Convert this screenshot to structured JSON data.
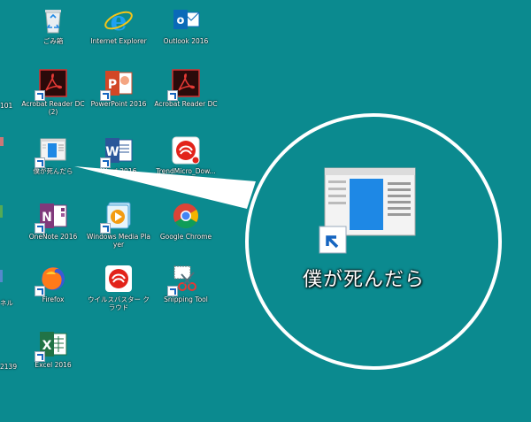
{
  "desktop": {
    "icons": [
      {
        "id": "recycle",
        "label": "ごみ箱"
      },
      {
        "id": "ie",
        "label": "Internet Explorer"
      },
      {
        "id": "outlook",
        "label": "Outlook 2016"
      },
      {
        "id": "acrobat2",
        "label": "Acrobat Reader DC (2)"
      },
      {
        "id": "powerpoint",
        "label": "PowerPoint 2016"
      },
      {
        "id": "acrobat",
        "label": "Acrobat Reader DC"
      },
      {
        "id": "bokuga",
        "label": "僕が死んだら"
      },
      {
        "id": "word",
        "label": "Word 2016"
      },
      {
        "id": "trendmicro",
        "label": "TrendMicro_Dow..."
      },
      {
        "id": "onenote",
        "label": "OneNote 2016"
      },
      {
        "id": "wmp",
        "label": "Windows Media Player"
      },
      {
        "id": "chrome",
        "label": "Google Chrome"
      },
      {
        "id": "firefox",
        "label": "Firefox"
      },
      {
        "id": "virusbuster",
        "label": "ウイルスバスター クラウド"
      },
      {
        "id": "snipping",
        "label": "Snipping Tool"
      },
      {
        "id": "excel",
        "label": "Excel 2016"
      }
    ],
    "edge_labels": [
      "101",
      "ネル",
      "2139"
    ]
  },
  "zoom": {
    "label": "僕が死んだら"
  },
  "colors": {
    "background": "#0b8a8f",
    "accent": "#1e88e5"
  }
}
